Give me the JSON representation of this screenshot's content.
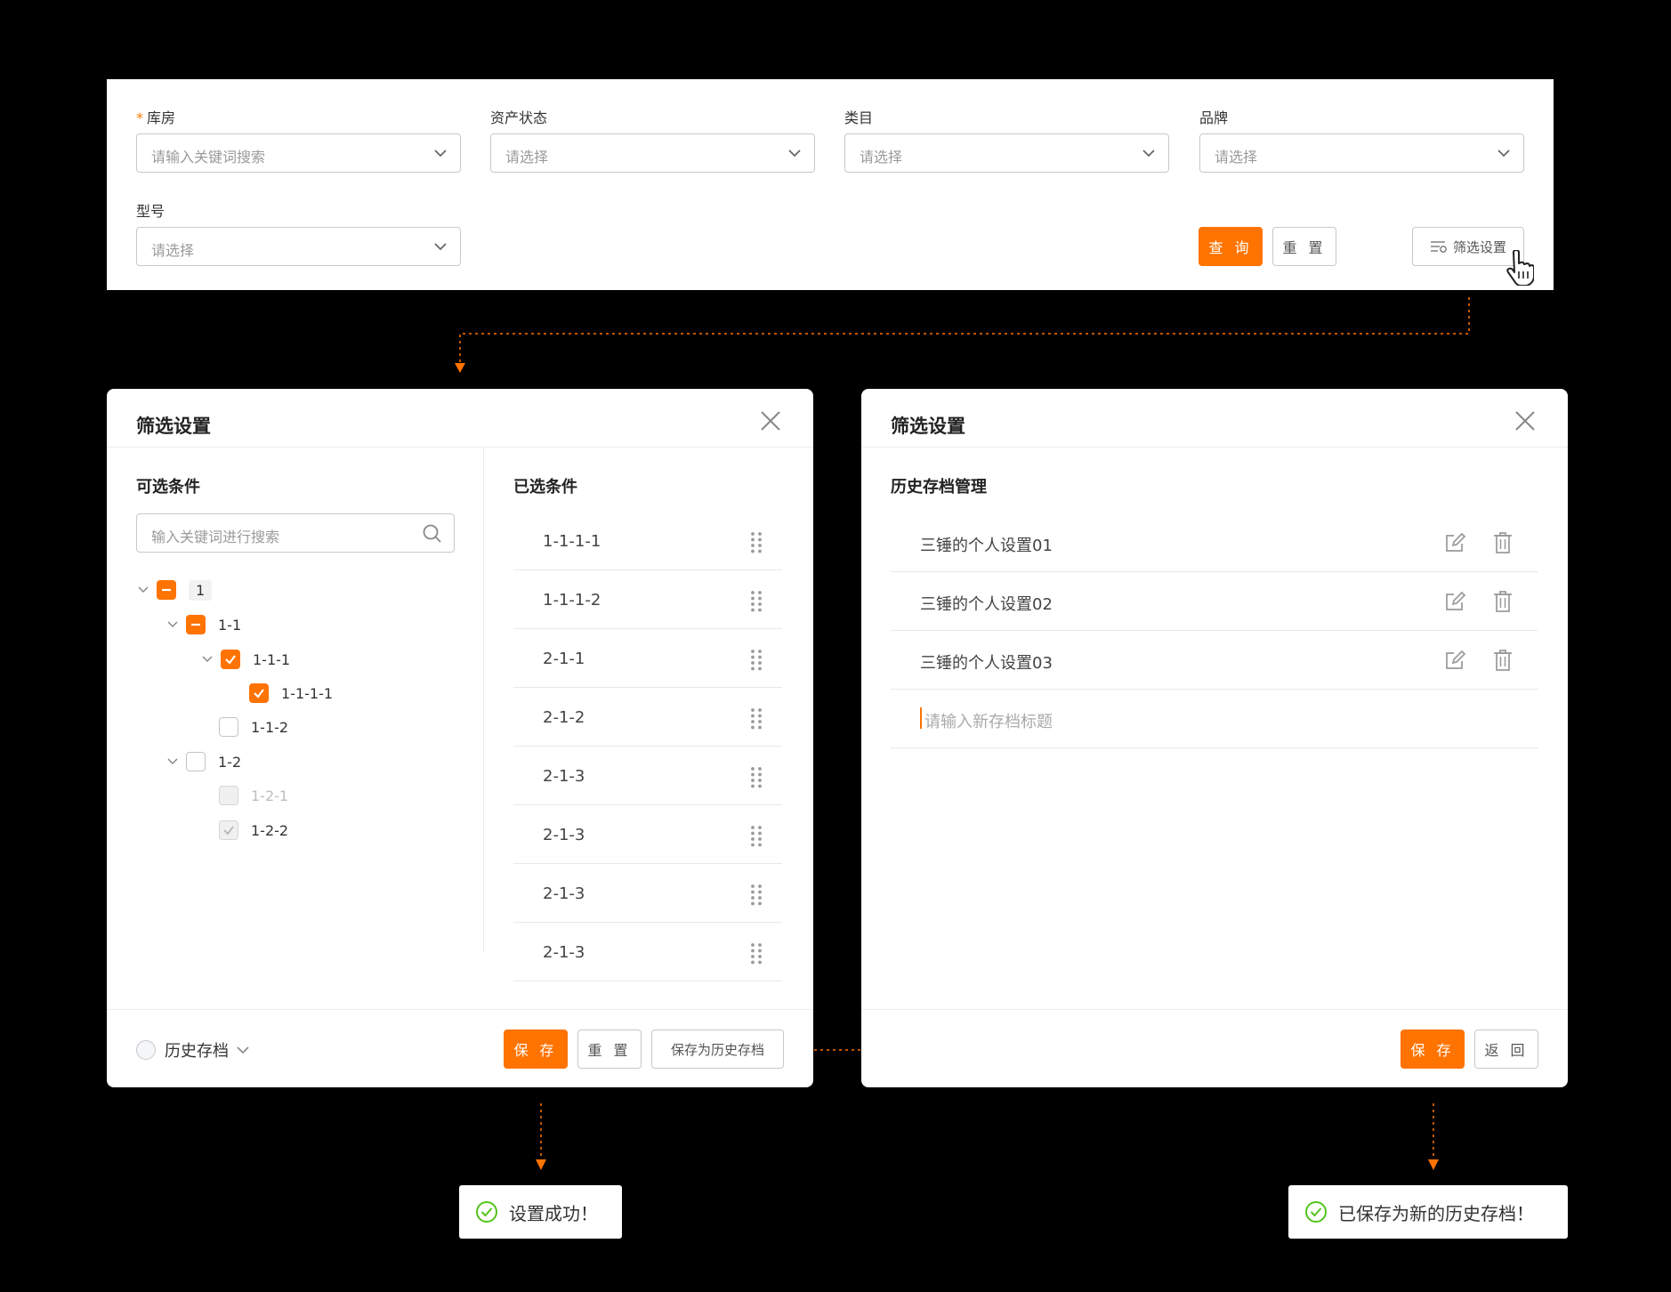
{
  "filter": {
    "fields": [
      {
        "label": "库房",
        "required": "*",
        "placeholder": "请输入关键词搜索"
      },
      {
        "label": "资产状态",
        "placeholder": "请选择"
      },
      {
        "label": "类目",
        "placeholder": "请选择"
      },
      {
        "label": "品牌",
        "placeholder": "请选择"
      },
      {
        "label": "型号",
        "placeholder": "请选择"
      }
    ],
    "query_label": "查 询",
    "reset_label": "重 置",
    "settings_label": "筛选设置"
  },
  "dialog_left": {
    "title": "筛选设置",
    "available_title": "可选条件",
    "search_placeholder": "输入关键词进行搜索",
    "tree": [
      {
        "label": "1",
        "state": "indeterminate"
      },
      {
        "label": "1-1",
        "state": "indeterminate"
      },
      {
        "label": "1-1-1",
        "state": "checked"
      },
      {
        "label": "1-1-1-1",
        "state": "checked"
      },
      {
        "label": "1-1-2",
        "state": "unchecked"
      },
      {
        "label": "1-2",
        "state": "unchecked"
      },
      {
        "label": "1-2-1",
        "state": "disabled"
      },
      {
        "label": "1-2-2",
        "state": "disabled-checked"
      }
    ],
    "selected_title": "已选条件",
    "selected": [
      "1-1-1-1",
      "1-1-1-2",
      "2-1-1",
      "2-1-2",
      "2-1-3",
      "2-1-3",
      "2-1-3",
      "2-1-3"
    ],
    "history_label": "历史存档",
    "save_label": "保 存",
    "reset_label": "重 置",
    "save_history_label": "保存为历史存档"
  },
  "dialog_right": {
    "title": "筛选设置",
    "section_title": "历史存档管理",
    "items": [
      "三锤的个人设置01",
      "三锤的个人设置02",
      "三锤的个人设置03"
    ],
    "new_placeholder": "请输入新存档标题",
    "save_label": "保 存",
    "back_label": "返 回"
  },
  "toasts": {
    "left": "设置成功！",
    "right": "已保存为新的历史存档！"
  },
  "colors": {
    "accent": "#ff7300",
    "success": "#52c41a"
  }
}
